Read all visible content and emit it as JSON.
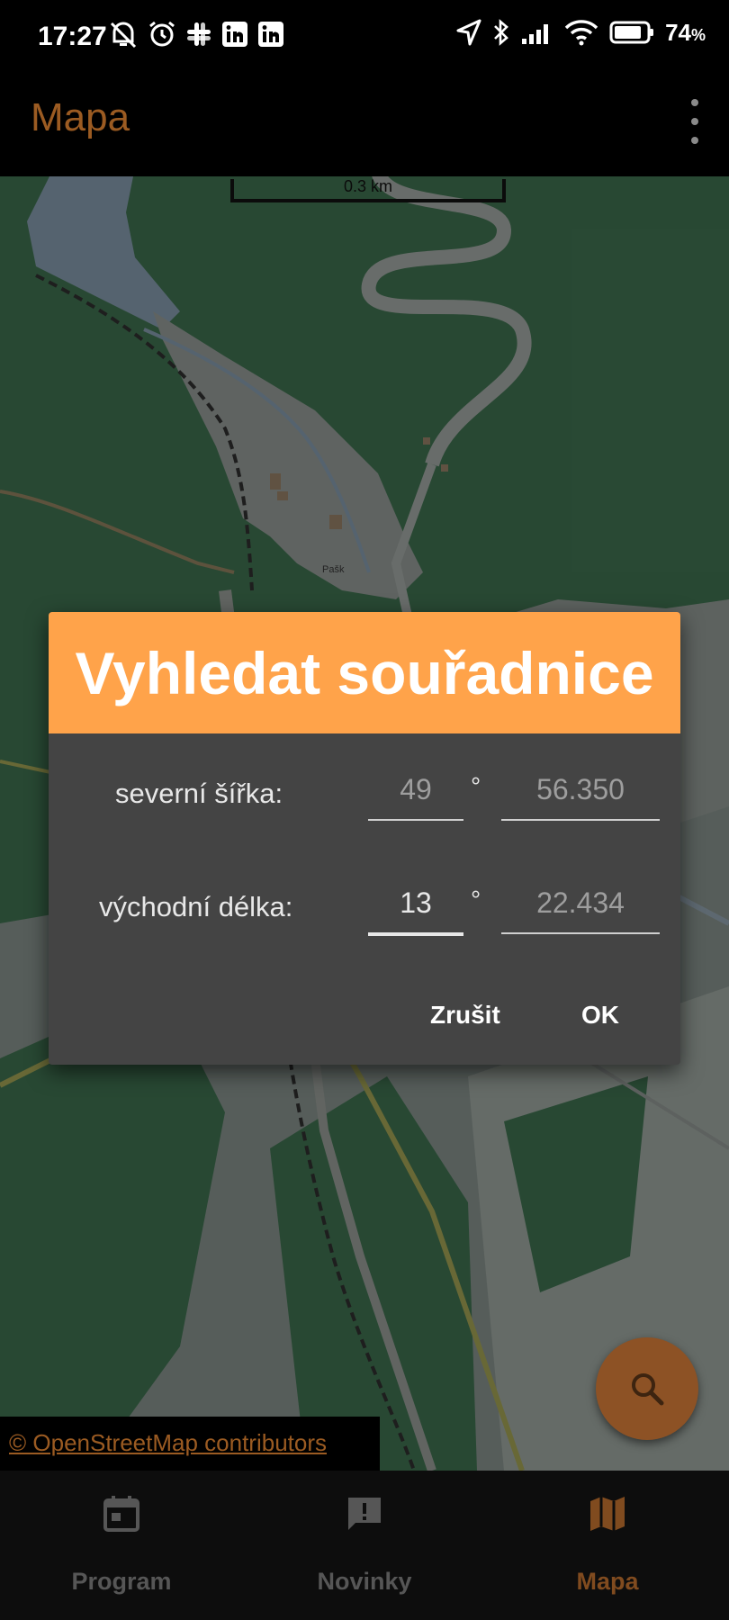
{
  "status_bar": {
    "time": "17:27",
    "battery": "74",
    "battery_unit": "%",
    "left_icons": [
      "mute-bell-icon",
      "alarm-icon",
      "slack-icon",
      "linkedin-icon",
      "linkedin-icon"
    ],
    "right_icons": [
      "location-arrow-icon",
      "bluetooth-icon",
      "signal-icon",
      "wifi-icon",
      "battery-icon"
    ]
  },
  "app_bar": {
    "title": "Mapa",
    "overflow_icon": "more-vert-icon"
  },
  "map": {
    "scale_label": "0.3 km",
    "place_label": "Pašk",
    "attribution": "© OpenStreetMap contributors"
  },
  "dialog": {
    "title": "Vyhledat souřadnice",
    "north": {
      "label": "severní šířka:",
      "degrees": "49",
      "minutes": "56.350"
    },
    "east": {
      "label": "východní délka:",
      "degrees": "13",
      "minutes": "22.434"
    },
    "degree_symbol": "°",
    "cancel": "Zrušit",
    "ok": "OK"
  },
  "fab": {
    "icon": "search-icon"
  },
  "bottom_nav": {
    "items": [
      {
        "label": "Program",
        "icon": "calendar-icon",
        "active": false
      },
      {
        "label": "Novinky",
        "icon": "announcement-icon",
        "active": false
      },
      {
        "label": "Mapa",
        "icon": "map-icon",
        "active": true
      }
    ]
  },
  "colors": {
    "accent": "#ffa34a",
    "accent_dim": "#804b1f",
    "dialog_bg": "#444444",
    "forest": "#3c6b4c"
  }
}
